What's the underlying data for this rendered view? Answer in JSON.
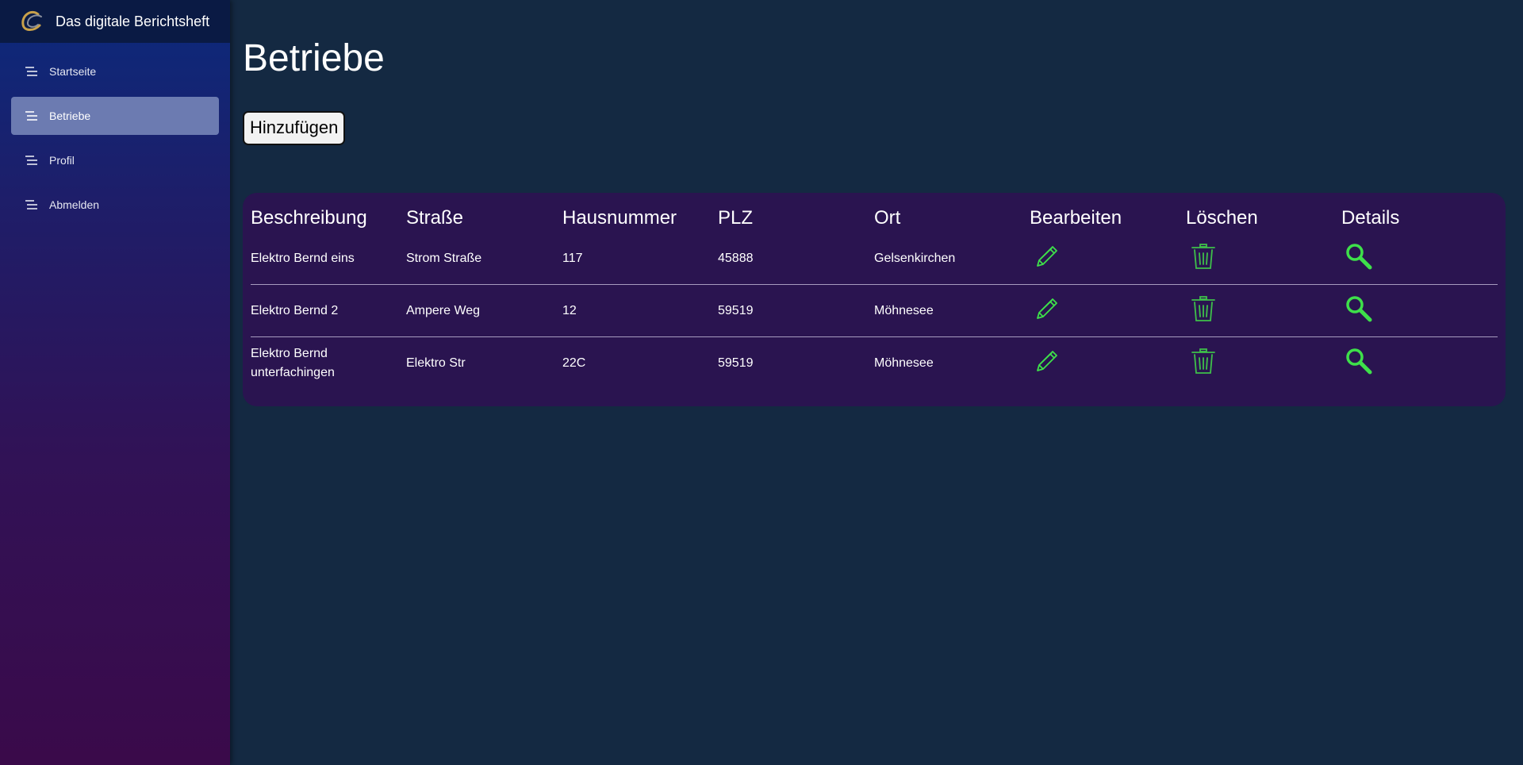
{
  "app": {
    "title": "Das digitale Berichtsheft"
  },
  "sidebar": {
    "items": [
      {
        "label": "Startseite",
        "active": false,
        "icon": "menu-lines-icon"
      },
      {
        "label": "Betriebe",
        "active": true,
        "icon": "menu-lines-icon"
      },
      {
        "label": "Profil",
        "active": false,
        "icon": "menu-lines-icon"
      },
      {
        "label": "Abmelden",
        "active": false,
        "icon": "menu-lines-icon"
      }
    ]
  },
  "main": {
    "title": "Betriebe",
    "add_button_label": "Hinzufügen",
    "table": {
      "headers": [
        "Beschreibung",
        "Straße",
        "Hausnummer",
        "PLZ",
        "Ort",
        "Bearbeiten",
        "Löschen",
        "Details"
      ],
      "rows": [
        {
          "beschreibung": "Elektro Bernd eins",
          "strasse": "Strom Straße",
          "hausnummer": "117",
          "plz": "45888",
          "ort": "Gelsenkirchen"
        },
        {
          "beschreibung": "Elektro Bernd 2",
          "strasse": "Ampere Weg",
          "hausnummer": "12",
          "plz": "59519",
          "ort": "Möhnesee"
        },
        {
          "beschreibung": "Elektro Bernd unterfachingen",
          "strasse": "Elektro Str",
          "hausnummer": "22C",
          "plz": "59519",
          "ort": "Möhnesee"
        }
      ],
      "icons": {
        "edit": "pencil-icon",
        "delete": "trash-icon",
        "details": "magnifier-icon"
      }
    }
  },
  "colors": {
    "background": "#142942",
    "sidebar_top": "#0b2a7c",
    "sidebar_bottom": "#3a0a4a",
    "active_item": "#6c7bb1",
    "table_bg": "#2a1450",
    "icon_accent": "#3ee04a"
  }
}
